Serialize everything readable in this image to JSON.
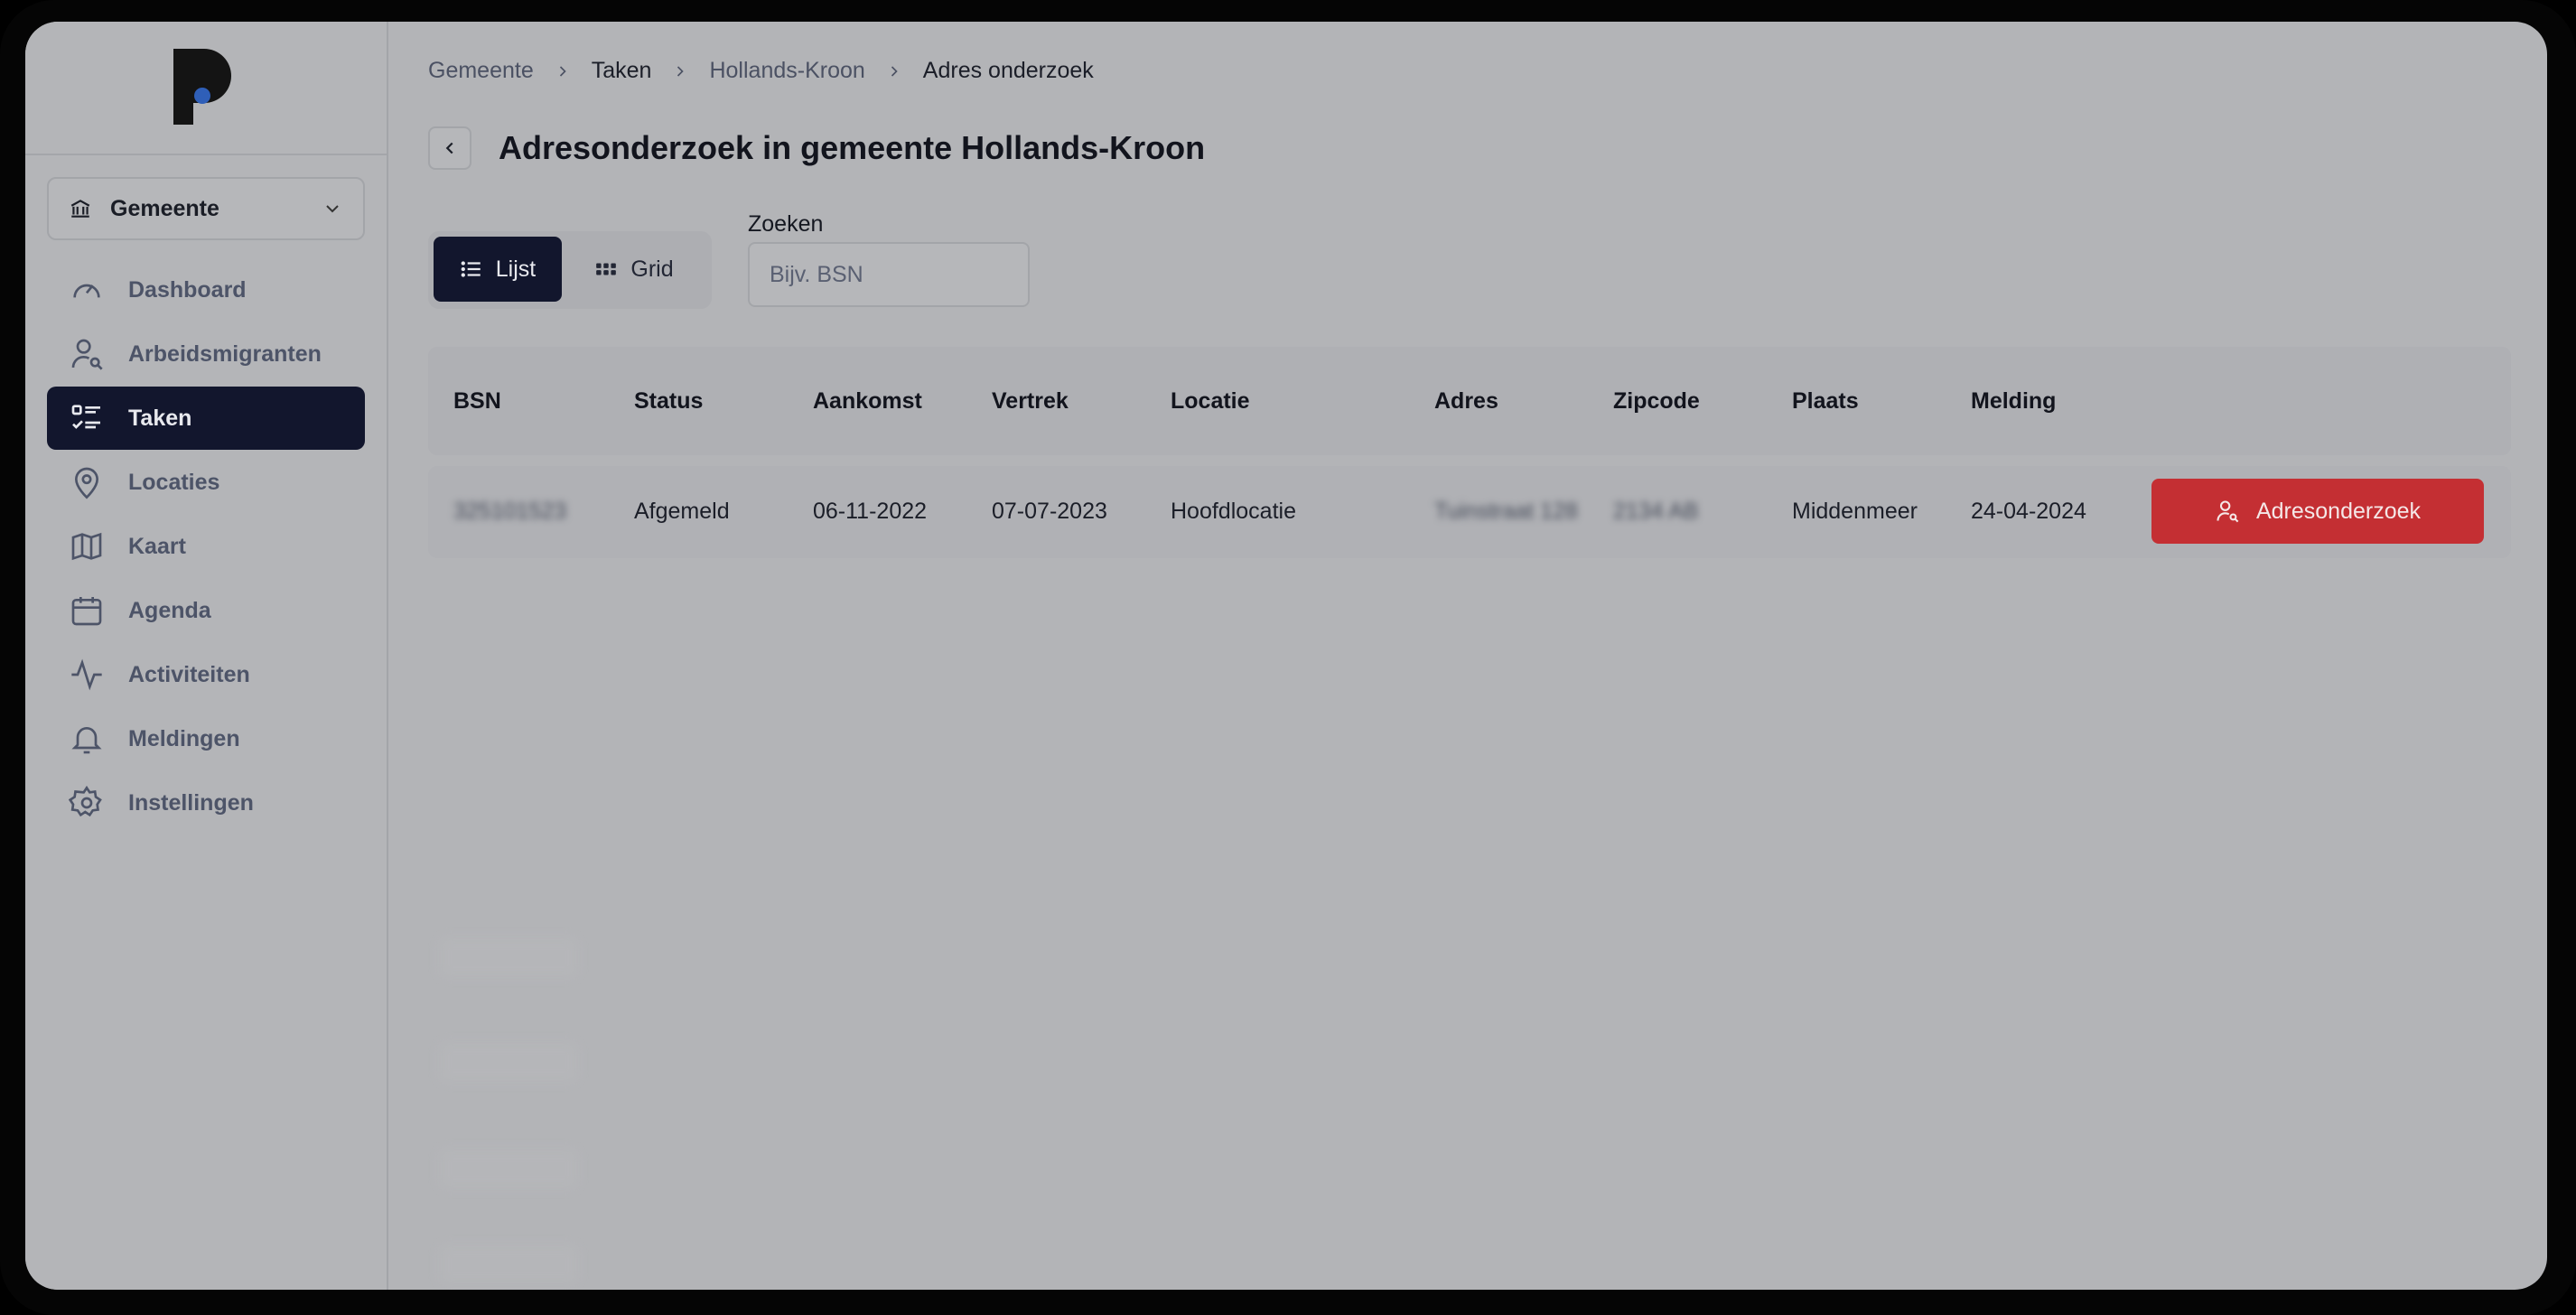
{
  "sidebar": {
    "org_select": {
      "label": "Gemeente"
    },
    "items": [
      {
        "label": "Dashboard",
        "icon": "gauge-icon"
      },
      {
        "label": "Arbeidsmigranten",
        "icon": "user-search-icon"
      },
      {
        "label": "Taken",
        "icon": "task-list-icon",
        "active": true
      },
      {
        "label": "Locaties",
        "icon": "map-pin-icon"
      },
      {
        "label": "Kaart",
        "icon": "map-icon"
      },
      {
        "label": "Agenda",
        "icon": "calendar-icon"
      },
      {
        "label": "Activiteiten",
        "icon": "activity-icon"
      },
      {
        "label": "Meldingen",
        "icon": "bell-icon"
      },
      {
        "label": "Instellingen",
        "icon": "gear-icon"
      }
    ]
  },
  "breadcrumb": [
    "Gemeente",
    "Taken",
    "Hollands-Kroon",
    "Adres onderzoek"
  ],
  "page": {
    "title": "Adresonderzoek in gemeente Hollands-Kroon"
  },
  "view_toggle": {
    "list_label": "Lijst",
    "grid_label": "Grid",
    "selected": "Lijst"
  },
  "search": {
    "label": "Zoeken",
    "placeholder": "Bijv. BSN",
    "value": ""
  },
  "table": {
    "columns": [
      "BSN",
      "Status",
      "Aankomst",
      "Vertrek",
      "Locatie",
      "Adres",
      "Zipcode",
      "Plaats",
      "Melding"
    ],
    "rows": [
      {
        "bsn": "325101523",
        "status": "Afgemeld",
        "aankomst": "06-11-2022",
        "vertrek": "07-07-2023",
        "locatie": "Hoofdlocatie",
        "adres": "Tuinstraat 128",
        "zipcode": "2134 AB",
        "plaats": "Middenmeer",
        "melding": "24-04-2024",
        "action_label": "Adresonderzoek"
      }
    ]
  },
  "colors": {
    "primary": "#12162d",
    "danger": "#c42f33",
    "logo_dot": "#2f5fb8"
  }
}
